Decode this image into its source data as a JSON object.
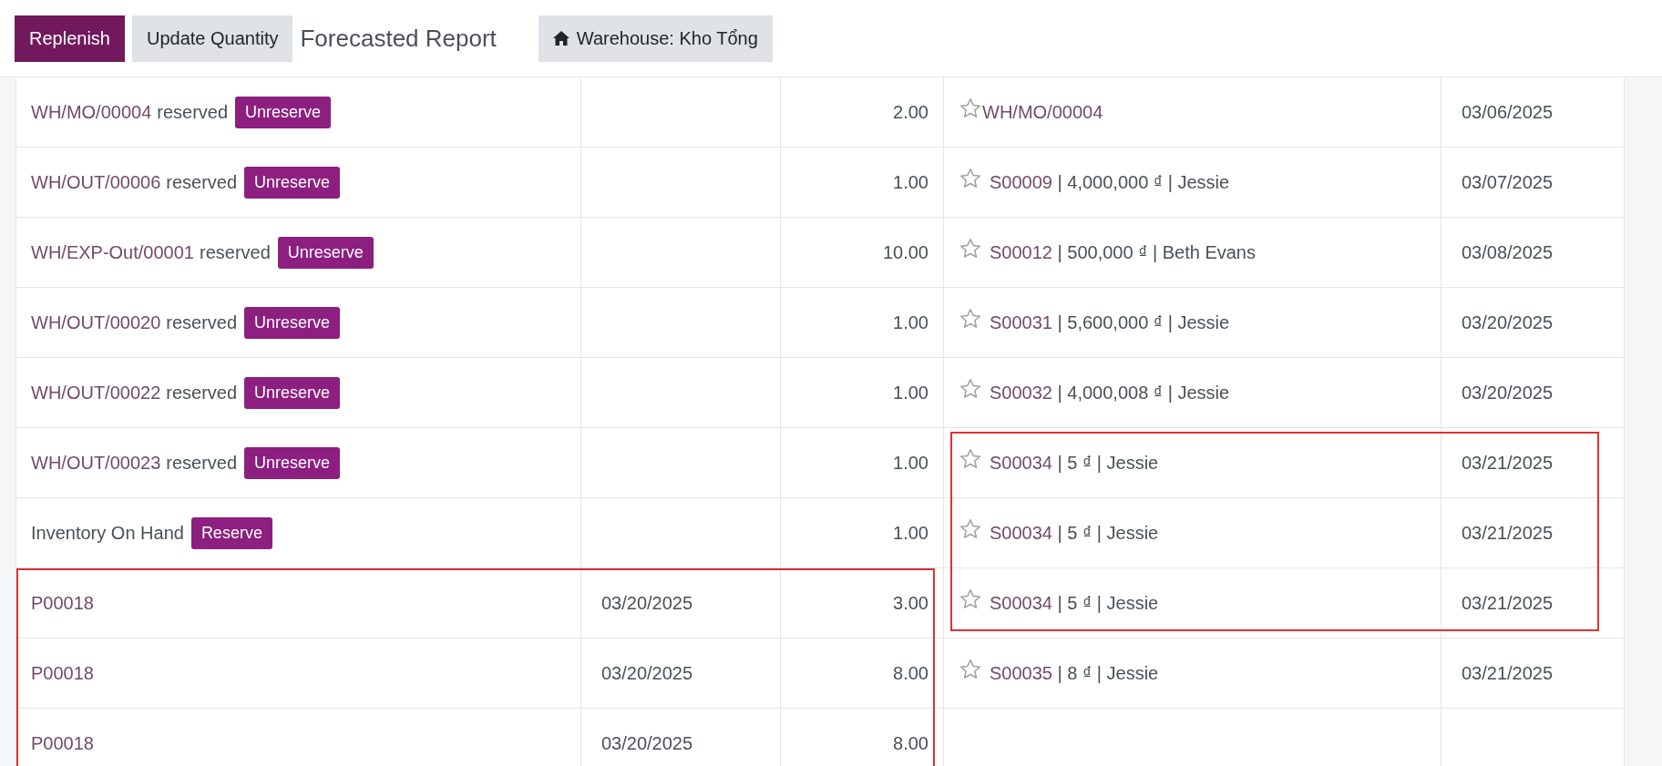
{
  "toolbar": {
    "buttons": [
      {
        "label": "Replenish",
        "kind": "primary"
      },
      {
        "label": "Update Quantity",
        "kind": "secondary"
      }
    ],
    "title": "Forecasted Report",
    "warehouse_button": "Warehouse: Kho Tổng"
  },
  "rows": [
    {
      "left": {
        "kind": "move",
        "reference": "WH/MO/00004",
        "suffix": "reserved",
        "action": "Unreserve",
        "quantity": "2.00",
        "highlighted": false
      },
      "right": {
        "starred": false,
        "reference": "WH/MO/00004",
        "date": "03/06/2025",
        "highlighted": false
      }
    },
    {
      "left": {
        "kind": "move",
        "reference": "WH/OUT/00006",
        "suffix": "reserved",
        "action": "Unreserve",
        "quantity": "1.00",
        "highlighted": false
      },
      "right": {
        "starred": false,
        "reference": "S00009",
        "details": " | 4,000,000 ₫ | Jessie",
        "date": "03/07/2025",
        "highlighted": false
      }
    },
    {
      "left": {
        "kind": "move",
        "reference": "WH/EXP-Out/00001",
        "suffix": "reserved",
        "action": "Unreserve",
        "quantity": "10.00",
        "highlighted": false
      },
      "right": {
        "starred": false,
        "reference": "S00012",
        "details": " | 500,000 ₫ | Beth Evans",
        "date": "03/08/2025",
        "highlighted": false
      }
    },
    {
      "left": {
        "kind": "move",
        "reference": "WH/OUT/00020",
        "suffix": "reserved",
        "action": "Unreserve",
        "quantity": "1.00",
        "highlighted": false
      },
      "right": {
        "starred": false,
        "reference": "S00031",
        "details": " | 5,600,000 ₫ | Jessie",
        "date": "03/20/2025",
        "highlighted": false
      }
    },
    {
      "left": {
        "kind": "move",
        "reference": "WH/OUT/00022",
        "suffix": "reserved",
        "action": "Unreserve",
        "quantity": "1.00",
        "highlighted": false
      },
      "right": {
        "starred": false,
        "reference": "S00032",
        "details": " | 4,000,008 ₫ | Jessie",
        "date": "03/20/2025",
        "highlighted": false
      }
    },
    {
      "left": {
        "kind": "move",
        "reference": "WH/OUT/00023",
        "suffix": "reserved",
        "action": "Unreserve",
        "quantity": "1.00",
        "highlighted": false
      },
      "right": {
        "starred": false,
        "reference": "S00034",
        "details": " | 5 ₫ | Jessie",
        "date": "03/21/2025",
        "highlighted": true
      }
    },
    {
      "left": {
        "kind": "stock",
        "label": "Inventory On Hand",
        "action": "Reserve",
        "quantity": "1.00",
        "highlighted": false
      },
      "right": {
        "starred": false,
        "reference": "S00034",
        "details": " | 5 ₫ | Jessie",
        "date": "03/21/2025",
        "highlighted": true
      }
    },
    {
      "left": {
        "kind": "receipt",
        "reference": "P00018",
        "date": "03/20/2025",
        "quantity": "3.00",
        "highlighted": true
      },
      "right": {
        "starred": false,
        "reference": "S00034",
        "details": " | 5 ₫ | Jessie",
        "date": "03/21/2025",
        "highlighted": true
      }
    },
    {
      "left": {
        "kind": "receipt",
        "reference": "P00018",
        "date": "03/20/2025",
        "quantity": "8.00",
        "highlighted": true
      },
      "right": {
        "starred": false,
        "reference": "S00035",
        "details": " | 8 ₫ | Jessie",
        "date": "03/21/2025",
        "highlighted": false
      }
    },
    {
      "left": {
        "kind": "receipt",
        "reference": "P00018",
        "date": "03/20/2025",
        "quantity": "8.00",
        "highlighted": true
      },
      "right": null
    }
  ]
}
